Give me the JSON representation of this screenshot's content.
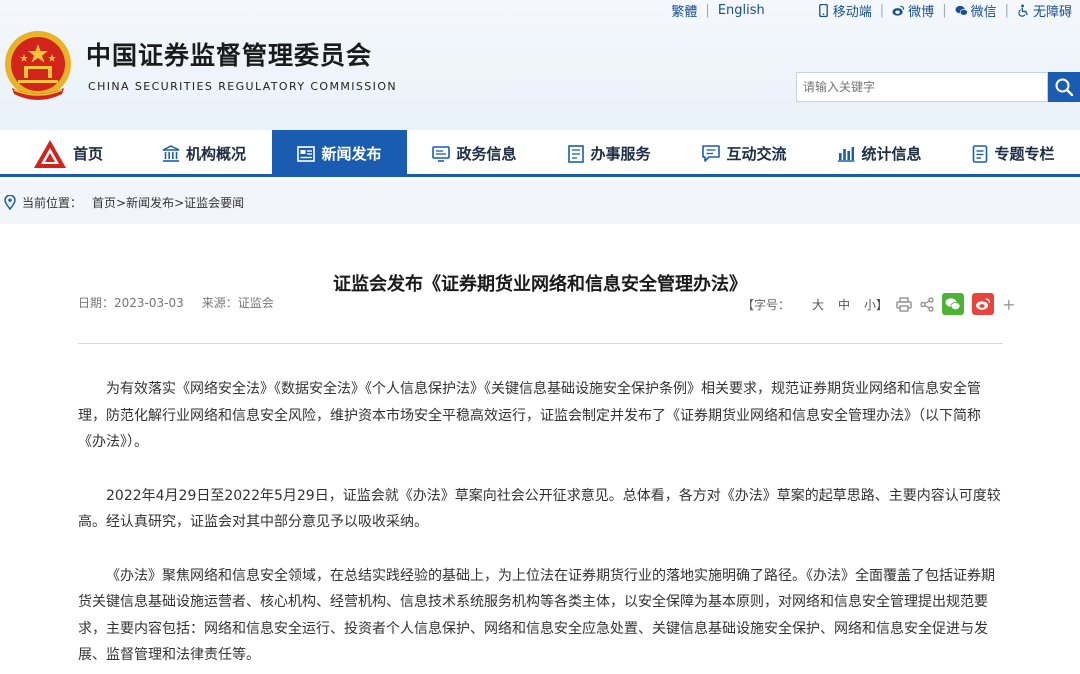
{
  "topbar": {
    "traditional": "繁體",
    "english": "English",
    "mobile": "移动端",
    "weibo": "微博",
    "wechat": "微信",
    "accessibility": "无障碍"
  },
  "header": {
    "title": "中国证券监督管理委员会",
    "subtitle": "CHINA SECURITIES REGULATORY COMMISSION",
    "search_placeholder": "请输入关键字"
  },
  "nav": {
    "items": [
      {
        "label": "首页",
        "icon": "csrc-logo-icon"
      },
      {
        "label": "机构概况",
        "icon": "institution-icon"
      },
      {
        "label": "新闻发布",
        "icon": "news-icon",
        "active": true
      },
      {
        "label": "政务信息",
        "icon": "monitor-icon"
      },
      {
        "label": "办事服务",
        "icon": "list-icon"
      },
      {
        "label": "互动交流",
        "icon": "chat-icon"
      },
      {
        "label": "统计信息",
        "icon": "bar-chart-icon"
      },
      {
        "label": "专题专栏",
        "icon": "document-icon"
      }
    ],
    "active_color": "#1a5db0"
  },
  "breadcrumb": {
    "label": "当前位置：",
    "path": "首页>新闻发布>证监会要闻"
  },
  "article": {
    "title": "证监会发布《证券期货业网络和信息安全管理办法》",
    "date": "日期：2023-03-03",
    "source": "来源：证监会",
    "font_size_label": "【字号：",
    "font_large": "大",
    "font_medium": "中",
    "font_small": "小】",
    "paragraphs": [
      "为有效落实《网络安全法》《数据安全法》《个人信息保护法》《关键信息基础设施安全保护条例》相关要求，规范证券期货业网络和信息安全管理，防范化解行业网络和信息安全风险，维护资本市场安全平稳高效运行，证监会制定并发布了《证券期货业网络和信息安全管理办法》（以下简称《办法》）。",
      "2022年4月29日至2022年5月29日，证监会就《办法》草案向社会公开征求意见。总体看，各方对《办法》草案的起草思路、主要内容认可度较高。经认真研究，证监会对其中部分意见予以吸收采纳。",
      "《办法》聚焦网络和信息安全领域，在总结实践经验的基础上，为上位法在证券期货行业的落地实施明确了路径。《办法》全面覆盖了包括证券期货关键信息基础设施运营者、核心机构、经营机构、信息技术系统服务机构等各类主体，以安全保障为基本原则，对网络和信息安全管理提出规范要求，主要内容包括：网络和信息安全运行、投资者个人信息保护、网络和信息安全应急处置、关键信息基础设施安全保护、网络和信息安全促进与发展、监督管理和法律责任等。"
    ]
  }
}
